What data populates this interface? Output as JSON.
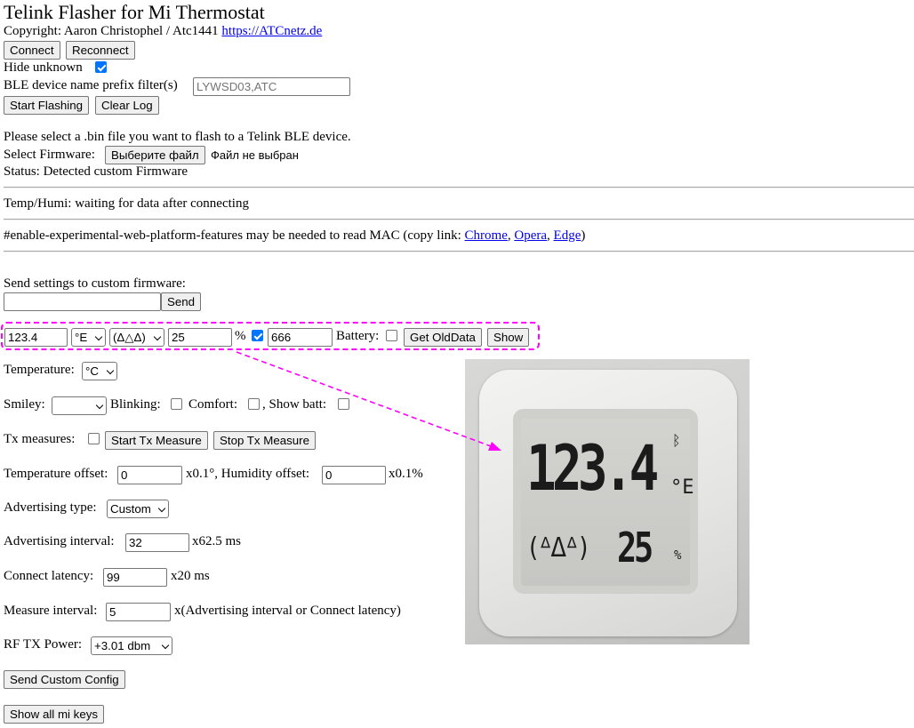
{
  "page": {
    "title": "Telink Flasher for Mi Thermostat",
    "copyright_prefix": "Copyright: Aaron Christophel / Atc1441 ",
    "copyright_link": "https://ATCnetz.de"
  },
  "buttons": {
    "connect": "Connect",
    "reconnect": "Reconnect",
    "start_flashing": "Start Flashing",
    "clear_log": "Clear Log",
    "choose_file": "Выберите файл",
    "send": "Send",
    "get_olddata": "Get OldData",
    "show": "Show",
    "start_tx": "Start Tx Measure",
    "stop_tx": "Stop Tx Measure",
    "send_custom_config": "Send Custom Config",
    "show_all_mi_keys": "Show all mi keys"
  },
  "hide_unknown": {
    "label": "Hide unknown",
    "checked": true
  },
  "prefix_filter": {
    "label": "BLE device name prefix filter(s)",
    "placeholder": "LYWSD03,ATC"
  },
  "flash": {
    "instruction": "Please select a .bin file you want to flash to a Telink BLE device.",
    "select_label": "Select Firmware:",
    "no_file": "Файл не выбран",
    "status": "Status: Detected custom Firmware"
  },
  "temp_humi": "Temp/Humi: waiting for data after connecting",
  "mac_note": {
    "prefix": "#enable-experimental-web-platform-features may be needed to read MAC (copy link: ",
    "links": [
      "Chrome",
      "Opera",
      "Edge"
    ],
    "sep": ", ",
    "suffix": ")"
  },
  "send_settings": {
    "label": "Send settings to custom firmware:",
    "value": ""
  },
  "display_row": {
    "temp_value": "123.4",
    "unit_option": "°E",
    "smiley_option": "(Δ△Δ)",
    "humidity_value": "25",
    "percent": "%",
    "percent_checked": true,
    "battery_value": "666",
    "battery_label": "Battery:",
    "battery_checked": false
  },
  "settings": {
    "temperature_label": "Temperature:",
    "temperature_unit": "°C",
    "smiley_label": "Smiley:",
    "smiley_value": "",
    "blinking_label": "Blinking:",
    "comfort_label": "Comfort:",
    "show_batt_label": ", Show batt:",
    "tx_measures_label": "Tx measures:",
    "temp_offset_label": "Temperature offset:",
    "temp_offset_value": "0",
    "temp_offset_unit": "x0.1°, Humidity offset:",
    "hum_offset_value": "0",
    "hum_offset_unit": "x0.1%",
    "adv_type_label": "Advertising type:",
    "adv_type_value": "Custom",
    "adv_interval_label": "Advertising interval:",
    "adv_interval_value": "32",
    "adv_interval_unit": "x62.5 ms",
    "connect_latency_label": "Connect latency:",
    "connect_latency_value": "99",
    "connect_latency_unit": "x20 ms",
    "measure_interval_label": "Measure interval:",
    "measure_interval_value": "5",
    "measure_interval_unit": "x(Advertising interval or Connect latency)",
    "rf_power_label": "RF TX Power:",
    "rf_power_value": "+3.01 dbm"
  },
  "photo": {
    "lcd_temp": "123.4",
    "lcd_unit": "°E",
    "lcd_smiley": "(ᐞᐃᐞ)",
    "lcd_humidity": "25",
    "lcd_percent": "%",
    "bluetooth_icon": "bluetooth-icon"
  },
  "colors": {
    "annotation": "#ff00ff",
    "link": "#0000ee",
    "checkbox_on": "#0075ff"
  }
}
